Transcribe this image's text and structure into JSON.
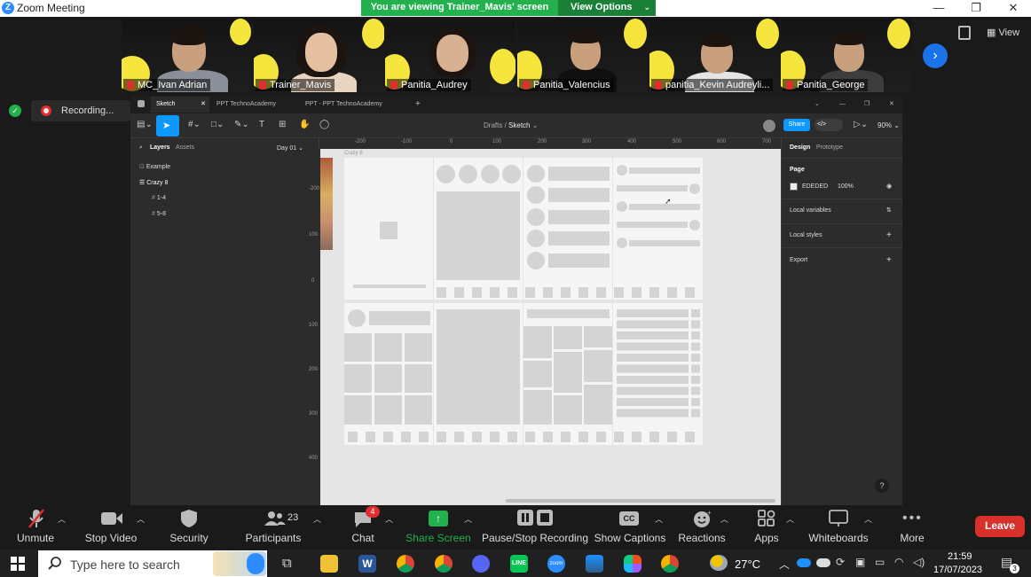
{
  "window": {
    "title": "Zoom Meeting",
    "minimize": "—",
    "restore": "❐",
    "close": "✕"
  },
  "share_banner": {
    "text": "You are viewing Trainer_Mavis' screen",
    "view_options": "View Options"
  },
  "view_button": "View",
  "participants_strip": [
    {
      "name": "MC_Ivan Adrian",
      "mic": "muted"
    },
    {
      "name": "Trainer_Mavis",
      "mic": "muted"
    },
    {
      "name": "Panitia_Audrey",
      "mic": "muted"
    },
    {
      "name": "Panitia_Valencius",
      "mic": "muted"
    },
    {
      "name": "panitia_Kevin Audreyli...",
      "mic": "muted"
    },
    {
      "name": "Panitia_George",
      "mic": "muted"
    }
  ],
  "recording": {
    "label": "Recording..."
  },
  "figma": {
    "tabs": [
      "Sketch",
      "PPT TechnoAcademy",
      "PPT - PPT TechnoAcademy"
    ],
    "breadcrumb": {
      "parent": "Drafts",
      "file": "Sketch"
    },
    "share": "Share",
    "zoom": "90%",
    "layers_tab": "Layers",
    "assets_tab": "Assets",
    "page_name": "Day 01",
    "layers": [
      {
        "label": "Example",
        "indent": 0
      },
      {
        "label": "Crazy 8",
        "indent": 0
      },
      {
        "label": "1-4",
        "indent": 1
      },
      {
        "label": "5-8",
        "indent": 1
      }
    ],
    "frame_label": "Crazy 8",
    "ruler_top": [
      "-200",
      "-100",
      "0",
      "100",
      "200",
      "300",
      "400",
      "500",
      "600",
      "700"
    ],
    "ruler_left": [
      "-200",
      "100",
      "0",
      "100",
      "200",
      "300",
      "400"
    ],
    "design_tab": "Design",
    "prototype_tab": "Prototype",
    "page_section": "Page",
    "page_color": "EDEDED",
    "page_opacity": "100%",
    "local_variables": "Local variables",
    "local_styles": "Local styles",
    "export": "Export",
    "help": "?"
  },
  "meeting_bar": {
    "unmute": "Unmute",
    "stop_video": "Stop Video",
    "security": "Security",
    "participants": "Participants",
    "participants_count": "23",
    "chat": "Chat",
    "chat_badge": "4",
    "share_screen": "Share Screen",
    "pause_stop": "Pause/Stop Recording",
    "captions": "Show Captions",
    "captions_icon": "CC",
    "reactions": "Reactions",
    "apps": "Apps",
    "whiteboards": "Whiteboards",
    "more": "More",
    "leave": "Leave"
  },
  "taskbar": {
    "search_placeholder": "Type here to search",
    "weather": "27°C",
    "time": "21:59",
    "date": "17/07/2023",
    "notifications": "3"
  },
  "colors": {
    "zoom_blue": "#2d8cff",
    "share_green": "#22b14c",
    "leave_red": "#d9302c",
    "figma_blue": "#0d99ff",
    "slide_yellow": "#f5e53d"
  }
}
